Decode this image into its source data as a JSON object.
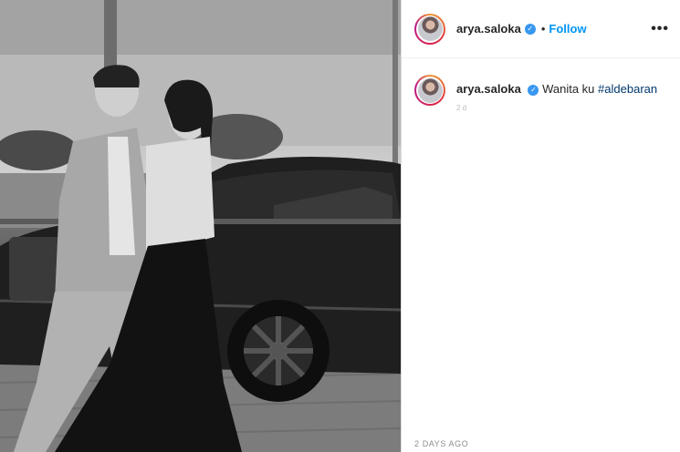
{
  "post": {
    "username": "arya.saloka",
    "follow_label": "Follow",
    "separator": "•",
    "more_label": "•••",
    "caption_text": "Wanita ku",
    "hashtag": "#aldebaran",
    "comment_time": "2 d",
    "date": "2 DAYS AGO",
    "image_alt": "Black and white photo of a man and a woman walking in front of a convertible car"
  },
  "colors": {
    "accent": "#0095f6",
    "verified": "#3897f0",
    "hashtag": "#00376b"
  }
}
